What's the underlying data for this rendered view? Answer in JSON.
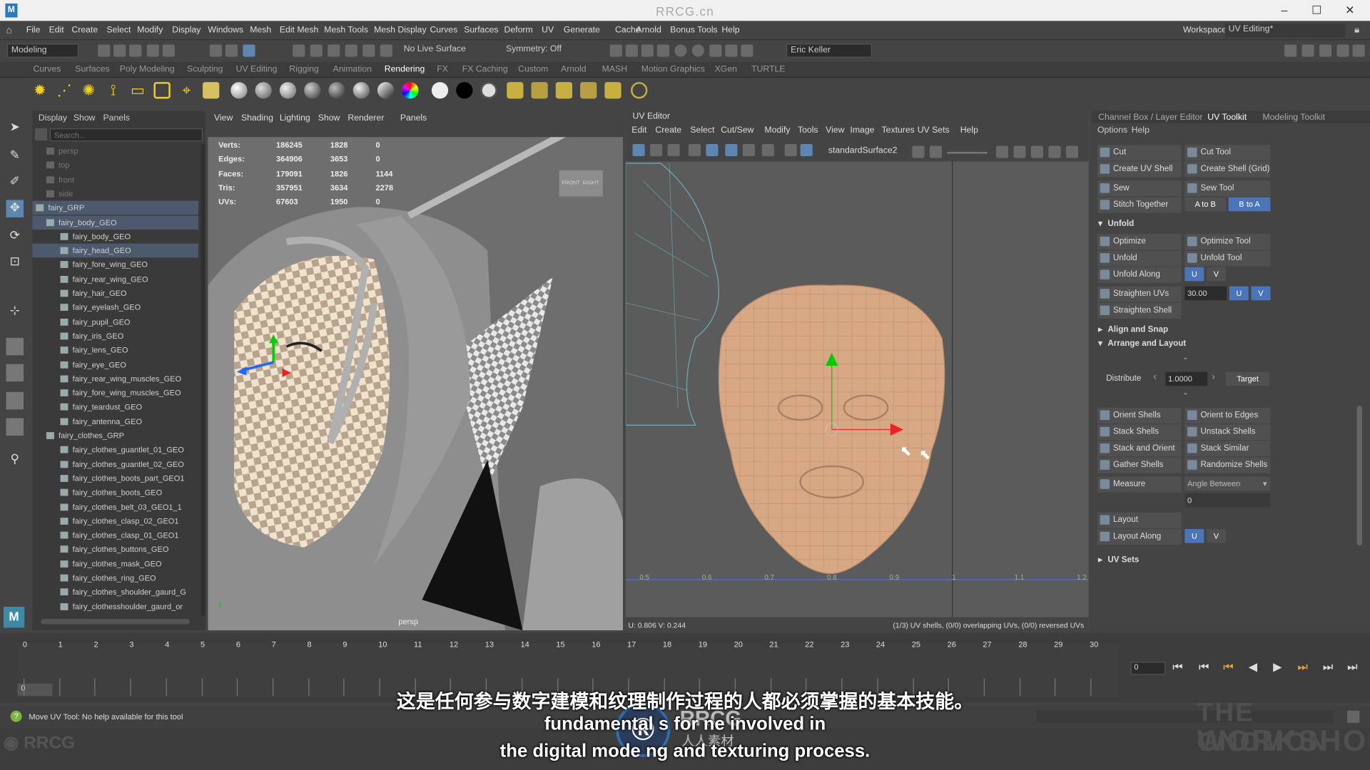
{
  "window": {
    "title": "RRCG.cn",
    "app_icon": "M"
  },
  "menu": [
    "File",
    "Edit",
    "Create",
    "Select",
    "Modify",
    "Display",
    "Windows",
    "Mesh",
    "Edit Mesh",
    "Mesh Tools",
    "Mesh Display",
    "Curves",
    "Surfaces",
    "Deform",
    "UV",
    "Generate",
    "Cache",
    "Arnold",
    "Bonus Tools",
    "Help"
  ],
  "workspace": {
    "label": "Workspace:",
    "value": "UV Editing*"
  },
  "toolbar": {
    "mode": "Modeling",
    "live_surface": "No Live Surface",
    "symmetry": "Symmetry: Off",
    "user": "Eric Keller"
  },
  "shelf_tabs": [
    "Curves",
    "Surfaces",
    "Poly Modeling",
    "Sculpting",
    "UV Editing",
    "Rigging",
    "Animation",
    "Rendering",
    "FX",
    "FX Caching",
    "Custom",
    "Arnold",
    "MASH",
    "Motion Graphics",
    "XGen",
    "TURTLE"
  ],
  "shelf_active": "Rendering",
  "outliner": {
    "menu": [
      "Display",
      "Show",
      "Panels"
    ],
    "search_placeholder": "Search...",
    "rows": [
      {
        "label": "persp",
        "indent": 1,
        "state": "dim"
      },
      {
        "label": "top",
        "indent": 1,
        "state": "dim"
      },
      {
        "label": "front",
        "indent": 1,
        "state": "dim"
      },
      {
        "label": "side",
        "indent": 1,
        "state": "dim"
      },
      {
        "label": "fairy_GRP",
        "indent": 0,
        "state": "sel"
      },
      {
        "label": "fairy_body_GEO",
        "indent": 1,
        "state": "sel"
      },
      {
        "label": "fairy_body_GEO",
        "indent": 2,
        "state": ""
      },
      {
        "label": "fairy_head_GEO",
        "indent": 2,
        "state": "sel"
      },
      {
        "label": "fairy_fore_wing_GEO",
        "indent": 2,
        "state": ""
      },
      {
        "label": "fairy_rear_wing_GEO",
        "indent": 2,
        "state": ""
      },
      {
        "label": "fairy_hair_GEO",
        "indent": 2,
        "state": ""
      },
      {
        "label": "fairy_eyelash_GEO",
        "indent": 2,
        "state": ""
      },
      {
        "label": "fairy_pupil_GEO",
        "indent": 2,
        "state": ""
      },
      {
        "label": "fairy_iris_GEO",
        "indent": 2,
        "state": ""
      },
      {
        "label": "fairy_lens_GEO",
        "indent": 2,
        "state": ""
      },
      {
        "label": "fairy_eye_GEO",
        "indent": 2,
        "state": ""
      },
      {
        "label": "fairy_rear_wing_muscles_GEO",
        "indent": 2,
        "state": ""
      },
      {
        "label": "fairy_fore_wing_muscles_GEO",
        "indent": 2,
        "state": ""
      },
      {
        "label": "fairy_teardust_GEO",
        "indent": 2,
        "state": ""
      },
      {
        "label": "fairy_antenna_GEO",
        "indent": 2,
        "state": ""
      },
      {
        "label": "fairy_clothes_GRP",
        "indent": 1,
        "state": ""
      },
      {
        "label": "fairy_clothes_guantlet_01_GEO",
        "indent": 2,
        "state": ""
      },
      {
        "label": "fairy_clothes_guantlet_02_GEO",
        "indent": 2,
        "state": ""
      },
      {
        "label": "fairy_clothes_boots_part_GEO1",
        "indent": 2,
        "state": ""
      },
      {
        "label": "fairy_clothes_boots_GEO",
        "indent": 2,
        "state": ""
      },
      {
        "label": "fairy_clothes_belt_03_GEO1_1",
        "indent": 2,
        "state": ""
      },
      {
        "label": "fairy_clothes_clasp_02_GEO1",
        "indent": 2,
        "state": ""
      },
      {
        "label": "fairy_clothes_clasp_01_GEO1",
        "indent": 2,
        "state": ""
      },
      {
        "label": "fairy_clothes_buttons_GEO",
        "indent": 2,
        "state": ""
      },
      {
        "label": "fairy_clothes_mask_GEO",
        "indent": 2,
        "state": ""
      },
      {
        "label": "fairy_clothes_ring_GEO",
        "indent": 2,
        "state": ""
      },
      {
        "label": "fairy_clothes_shoulder_gaurd_G",
        "indent": 2,
        "state": ""
      },
      {
        "label": "fairy_clothesshoulder_gaurd_or",
        "indent": 2,
        "state": ""
      }
    ]
  },
  "viewport": {
    "menu": [
      "View",
      "Shading",
      "Lighting",
      "Show",
      "Renderer",
      "Panels"
    ],
    "hud": [
      {
        "label": "Verts:",
        "a": "186245",
        "b": "1828",
        "c": "0"
      },
      {
        "label": "Edges:",
        "a": "364906",
        "b": "3653",
        "c": "0"
      },
      {
        "label": "Faces:",
        "a": "179091",
        "b": "1826",
        "c": "1144"
      },
      {
        "label": "Tris:",
        "a": "357951",
        "b": "3634",
        "c": "2278"
      },
      {
        "label": "UVs:",
        "a": "67603",
        "b": "1950",
        "c": "0"
      }
    ],
    "camera": "persp",
    "cube_front": "FRONT",
    "cube_right": "RIGHT"
  },
  "uv_editor": {
    "title": "UV Editor",
    "menu": [
      "Edit",
      "Create",
      "Select",
      "Cut/Sew",
      "Modify",
      "Tools",
      "View",
      "Image",
      "Textures",
      "UV Sets",
      "Help"
    ],
    "surface": "standardSurface2",
    "axis_ticks": [
      "0.5",
      "0.6",
      "0.7",
      "0.8",
      "0.9",
      "1",
      "1.1",
      "1.2"
    ],
    "coords": "U: 0.806  V: 0.244",
    "info": "(1/3) UV shells, (0/0) overlapping UVs, (0/0) reversed UVs"
  },
  "right_panel": {
    "tabs": [
      "Channel Box / Layer Editor",
      "UV Toolkit",
      "Modeling Toolkit"
    ],
    "active_tab": "UV Toolkit",
    "menu": [
      "Options",
      "Help"
    ],
    "cut": "Cut",
    "cut_tool": "Cut Tool",
    "create_uv_shell": "Create UV Shell",
    "create_shell_grid": "Create Shell (Grid)",
    "sew": "Sew",
    "sew_tool": "Sew Tool",
    "stitch_together": "Stitch Together",
    "a_to_b": "A to B",
    "b_to_a": "B to A",
    "unfold_section": "Unfold",
    "optimize": "Optimize",
    "optimize_tool": "Optimize Tool",
    "unfold": "Unfold",
    "unfold_tool": "Unfold Tool",
    "unfold_along": "Unfold Along",
    "u": "U",
    "v": "V",
    "straighten_uvs": "Straighten UVs",
    "straighten_value": "30.00",
    "straighten_shell": "Straighten Shell",
    "align_snap": "Align and Snap",
    "arrange_layout": "Arrange and Layout",
    "distribute": "Distribute",
    "distribute_value": "1.0000",
    "target": "Target",
    "orient_shells": "Orient Shells",
    "orient_edges": "Orient to Edges",
    "stack_shells": "Stack Shells",
    "unstack_shells": "Unstack Shells",
    "stack_orient": "Stack and Orient",
    "stack_similar": "Stack Similar",
    "gather_shells": "Gather Shells",
    "randomize_shells": "Randomize Shells",
    "measure": "Measure",
    "measure_mode": "Angle Between",
    "measure_value": "0",
    "layout": "Layout",
    "layout_along": "Layout Along",
    "uv_sets": "UV Sets"
  },
  "timeline": {
    "ticks": [
      "0",
      "1",
      "2",
      "3",
      "4",
      "5",
      "6",
      "7",
      "8",
      "9",
      "10",
      "11",
      "12",
      "13",
      "14",
      "15",
      "16",
      "17",
      "18",
      "19",
      "20",
      "21",
      "22",
      "23",
      "24",
      "25",
      "26",
      "27",
      "28",
      "29",
      "30"
    ],
    "current": "0",
    "frame_field": "0"
  },
  "status": {
    "message": "Move UV Tool: No help available for this tool"
  },
  "subtitles": {
    "zh": "这是任何参与数字建模和纹理制作过程的人都必须掌握的基本技能。",
    "en1": "fundamental s   for   ne involved in",
    "en2": "the digital mode  ng and texturing process."
  },
  "watermarks": {
    "center": "RRCG",
    "center_sub": "人人素材",
    "left": "RRCG",
    "right_top": "THE GNOMON",
    "right_bottom": "WORKSHOP"
  }
}
